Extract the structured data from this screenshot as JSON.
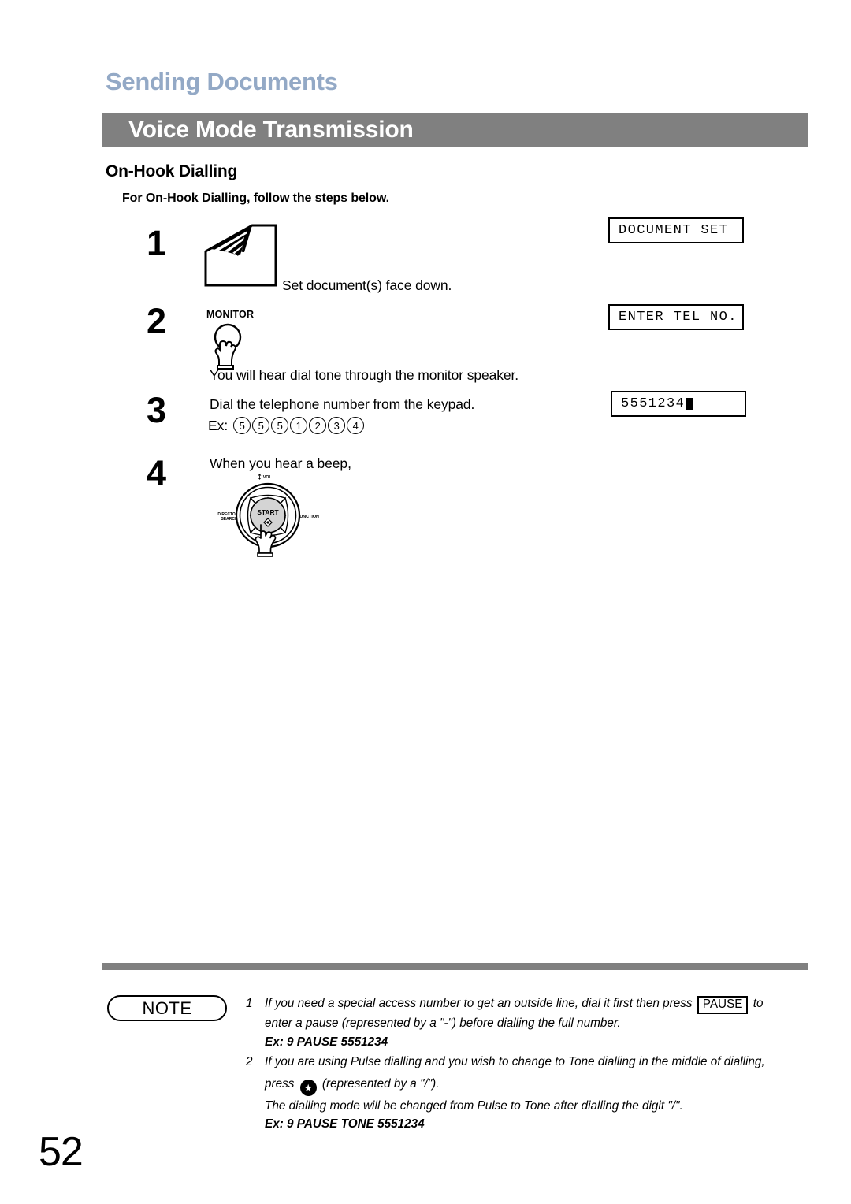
{
  "page": {
    "chapter_title": "Sending Documents",
    "section_title": "Voice Mode Transmission",
    "subject_heading": "On-Hook Dialling",
    "intro_line": "For On-Hook Dialling, follow the steps below.",
    "page_number": "52",
    "accent_color": "#93a9c6",
    "bar_color": "#808080"
  },
  "steps": [
    {
      "number": "1",
      "icon": "document-stack-icon",
      "text": "Set document(s) face down."
    },
    {
      "number": "2",
      "icon": "monitor-key-icon",
      "key_label": "MONITOR",
      "text": "You will hear dial tone through the monitor speaker."
    },
    {
      "number": "3",
      "text": "Dial the telephone number from the keypad.",
      "example_label": "Ex:",
      "example_digits": [
        "5",
        "5",
        "5",
        "1",
        "2",
        "3",
        "4"
      ]
    },
    {
      "number": "4",
      "text": "When you hear a beep,",
      "icon": "start-dial-pad-icon",
      "dial": {
        "center_label": "START",
        "top_label": "VOL.",
        "left_label_line1": "DIRECTORY",
        "left_label_line2": "SEARCH",
        "right_label": "FUNCTION"
      }
    }
  ],
  "displays": [
    {
      "text": "DOCUMENT SET",
      "cursor": false
    },
    {
      "text": "ENTER TEL NO.",
      "cursor": false
    },
    {
      "text": "5551234",
      "cursor": true
    }
  ],
  "note": {
    "badge_label": "NOTE",
    "items": [
      {
        "index": "1",
        "line1_a": "If you need a special access number to get an outside line, dial it first then press",
        "key": "PAUSE",
        "line1_b": "to",
        "line2": "enter a pause (represented by a \"-\") before dialling the full number.",
        "example": "Ex: 9 PAUSE 5551234"
      },
      {
        "index": "2",
        "line1": "If you are using Pulse dialling and you wish to change to Tone dialling in the middle of dialling,",
        "line2_a": "press",
        "star_key": "★",
        "line2_b": "(represented by a \"/\").",
        "line3": "The dialling mode will be changed from Pulse to Tone after dialling the digit \"/\".",
        "example": "Ex: 9 PAUSE TONE 5551234"
      }
    ]
  }
}
